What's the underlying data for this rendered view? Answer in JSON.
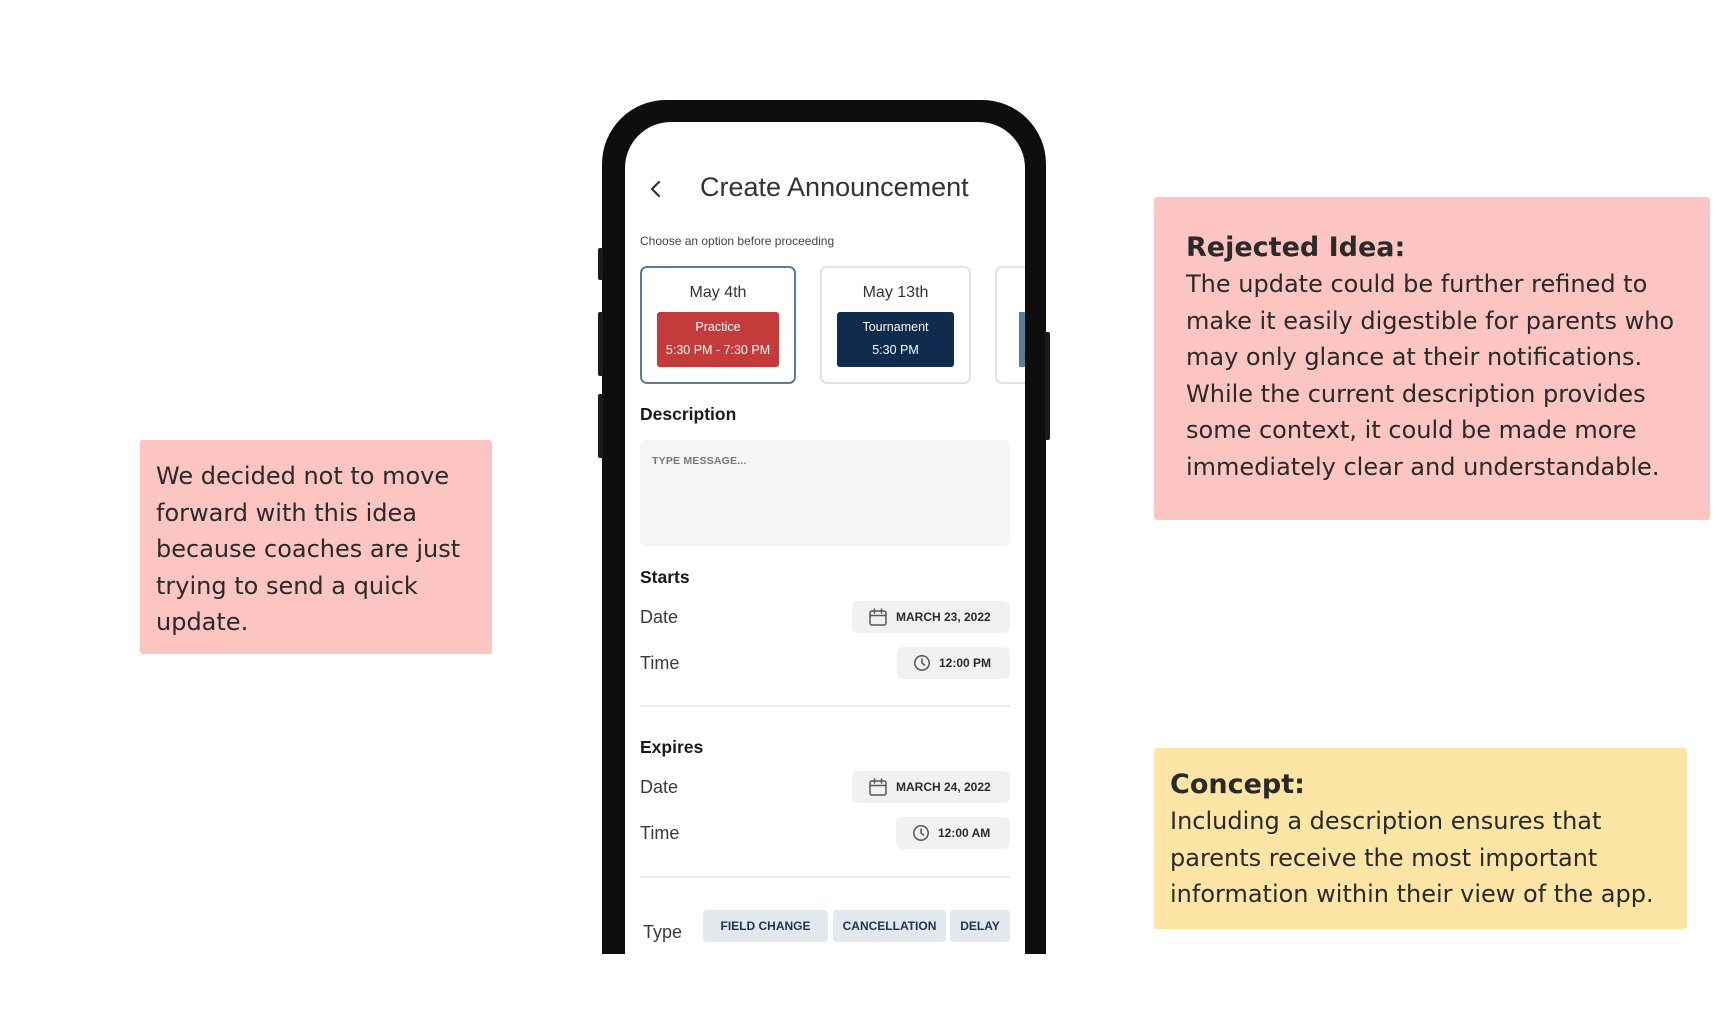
{
  "notes": {
    "left": {
      "text": "We decided not to move forward with this idea because coaches are just trying to send a quick update."
    },
    "rejected": {
      "heading": "Rejected Idea:",
      "body": "The update could be further refined to make it easily digestible for parents who may only glance at their notifications. While the current description provides some context, it could be made more immediately clear and understandable."
    },
    "concept": {
      "heading": "Concept:",
      "body": "Including a description ensures that parents receive the most important information within their view of the app."
    }
  },
  "screen": {
    "title": "Create Announcement",
    "hint": "Choose an option before proceeding",
    "events": [
      {
        "date": "May 4th",
        "type": "Practice",
        "time": "5:30 PM - 7:30 PM",
        "selected": true,
        "color": "#c53a3a"
      },
      {
        "date": "May 13th",
        "type": "Tournament",
        "time": "5:30 PM",
        "selected": false,
        "color": "#0f2b4e"
      }
    ],
    "description": {
      "label": "Description",
      "placeholder": "TYPE MESSAGE..."
    },
    "starts": {
      "label": "Starts",
      "date_label": "Date",
      "date_value": "MARCH 23, 2022",
      "time_label": "Time",
      "time_value": "12:00 PM"
    },
    "expires": {
      "label": "Expires",
      "date_label": "Date",
      "date_value": "MARCH 24, 2022",
      "time_label": "Time",
      "time_value": "12:00 AM"
    },
    "type": {
      "label": "Type",
      "options": [
        "FIELD CHANGE",
        "CANCELLATION",
        "DELAY"
      ]
    }
  },
  "icons": {
    "back": "chevron-left-icon",
    "calendar": "calendar-icon",
    "clock": "clock-icon"
  },
  "colors": {
    "note_pink": "#fcc5c1",
    "note_yellow": "#fde5a6",
    "selected_border": "#5d7c95",
    "type_chip_bg": "#e3e8ec"
  }
}
